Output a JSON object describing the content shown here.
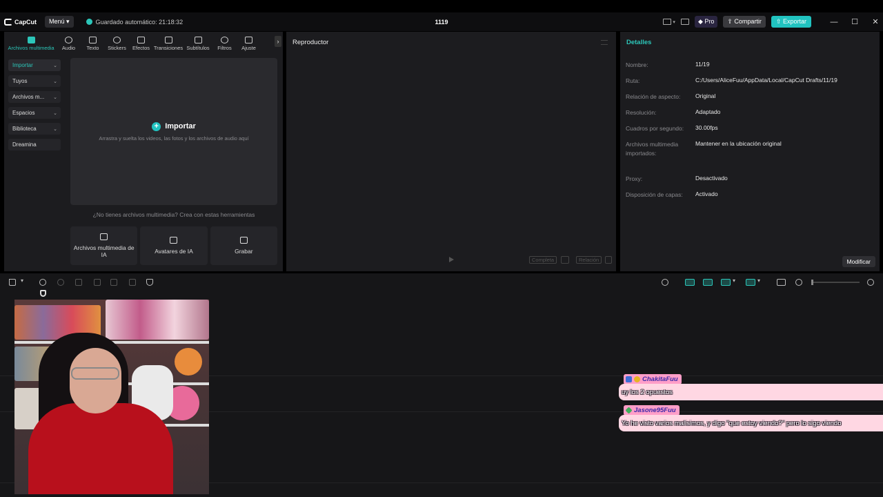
{
  "app": {
    "logo_text": "CapCut",
    "menu_label": "Menú",
    "autosave_text": "Guardado automático: 21:18:32",
    "project_title": "1119",
    "pro_label": "Pro",
    "share_label": "Compartir",
    "export_label": "Exportar",
    "window_controls": [
      "—",
      "☐",
      "✕"
    ]
  },
  "media_toolbar": [
    {
      "label": "Archivos multimedia",
      "icon": "media-icon",
      "active": true
    },
    {
      "label": "Audio",
      "icon": "audio-icon"
    },
    {
      "label": "Texto",
      "icon": "text-icon"
    },
    {
      "label": "Stickers",
      "icon": "sticker-icon"
    },
    {
      "label": "Efectos",
      "icon": "effects-icon"
    },
    {
      "label": "Transiciones",
      "icon": "transitions-icon"
    },
    {
      "label": "Subtítulos",
      "icon": "subtitles-icon"
    },
    {
      "label": "Filtros",
      "icon": "filters-icon"
    },
    {
      "label": "Ajuste",
      "icon": "adjust-icon"
    }
  ],
  "sidenav": [
    {
      "label": "Importar",
      "active": true
    },
    {
      "label": "Tuyos"
    },
    {
      "label": "Archivos m..."
    },
    {
      "label": "Espacios"
    },
    {
      "label": "Biblioteca"
    },
    {
      "label": "Dreamina"
    }
  ],
  "dropzone": {
    "import_label": "Importar",
    "hint": "Arrastra y suelta los videos, las fotos y los archivos de audio aquí"
  },
  "no_media_text": "¿No tienes archivos multimedia? Crea con estas herramientas",
  "create_tools": [
    {
      "label": "Archivos multimedia de IA",
      "icon": "ai-media-icon"
    },
    {
      "label": "Avatares de IA",
      "icon": "ai-avatar-icon"
    },
    {
      "label": "Grabar",
      "icon": "record-icon"
    }
  ],
  "player": {
    "title": "Reproductor",
    "full_label": "Completa",
    "ratio_label": "Relación"
  },
  "details": {
    "title": "Detalles",
    "rows": [
      {
        "label": "Nombre:",
        "value": "11/19"
      },
      {
        "label": "Ruta:",
        "value": "C:/Users/AliceFuu/AppData/Local/CapCut Drafts/11/19"
      },
      {
        "label": "Relación de aspecto:",
        "value": "Original"
      },
      {
        "label": "Resolución:",
        "value": "Adaptado"
      },
      {
        "label": "Cuadros por segundo:",
        "value": "30.00fps"
      },
      {
        "label": "Archivos multimedia importados:",
        "value": "Mantener en la ubicación original"
      },
      {
        "label": "Proxy:",
        "value": "Desactivado"
      },
      {
        "label": "Disposición de capas:",
        "value": "Activado"
      }
    ],
    "modify_label": "Modificar"
  },
  "chat": [
    {
      "user": "ChakitaFuu",
      "message": "uy los 2 opuestos"
    },
    {
      "user": "Jasone95Fuu",
      "message": "Yo he visto varios malisimos, y digo \"que estoy viendo?\" pero lo sigo viendo"
    }
  ],
  "colors": {
    "accent": "#21c3c0",
    "chat_name_bg": "#ff9ec8",
    "chat_msg_bg": "#ffd7e3"
  }
}
